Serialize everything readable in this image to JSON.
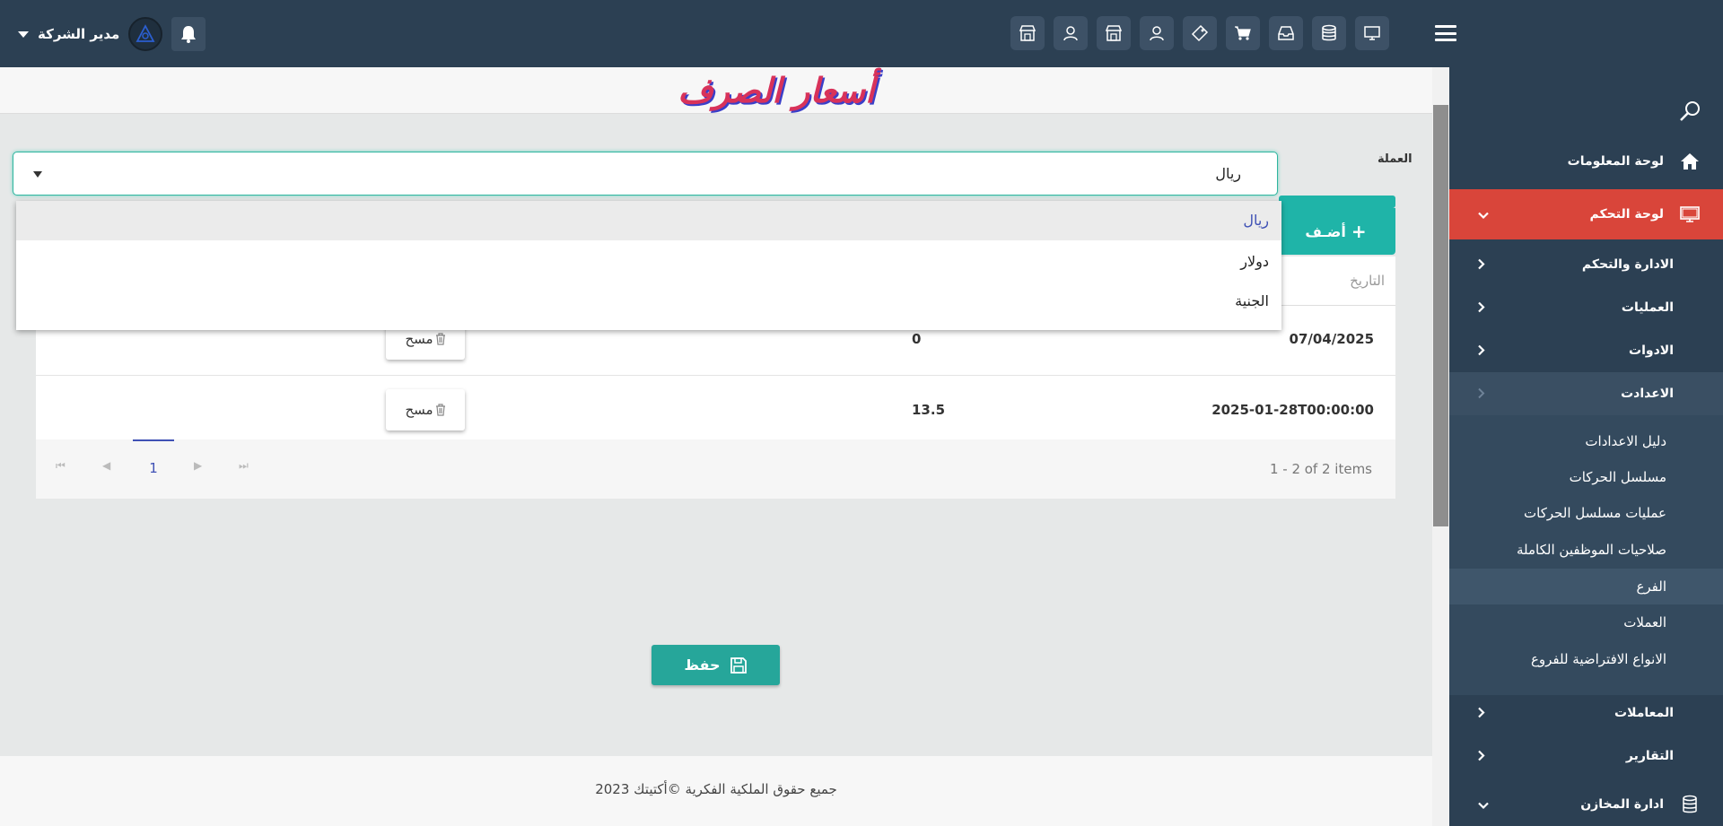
{
  "header": {
    "user_name": "مدير الشركة",
    "toolbar_icons": [
      "monitor-icon",
      "database-icon",
      "inbox-icon",
      "cart-icon",
      "tag-icon",
      "user-icon",
      "store-icon",
      "user-icon",
      "store-icon"
    ]
  },
  "page": {
    "title": "أسعار الصرف"
  },
  "form": {
    "currency_label": "العملة",
    "currency_selected": "ريال",
    "options": [
      "ريال",
      "دولار",
      "الجنية"
    ]
  },
  "grid": {
    "add_label": "أضـف",
    "date_header": "التاريخ",
    "rows": [
      {
        "date": "07/04/2025",
        "rate": "0",
        "delete_label": "مسح"
      },
      {
        "date": "2025-01-28T00:00:00",
        "rate": "13.5",
        "delete_label": "مسح"
      }
    ],
    "pager": {
      "current_page": "1",
      "info": "1 - 2 of 2 items"
    }
  },
  "actions": {
    "save_label": "حفظ"
  },
  "sidebar": {
    "items": [
      {
        "label": "لوحة المعلومات",
        "icon": "home-icon"
      },
      {
        "label": "لوحة التحكم",
        "icon": "monitor-icon"
      },
      {
        "label": "الادارة والتحكم"
      },
      {
        "label": "العمليات"
      },
      {
        "label": "الادوات"
      },
      {
        "label": "الاعدادت"
      }
    ],
    "submenu": [
      "دليل الاعدادات",
      "مسلسل الحركات",
      "عمليات مسلسل الحركات",
      "صلاحيات الموظفين الكاملة",
      "الفرع",
      "العملات",
      "الانواع الافتراضية للفروع"
    ],
    "bottom_items": [
      {
        "label": "المعاملات"
      },
      {
        "label": "التقارير"
      },
      {
        "label": "ادارة المخازن",
        "icon": "database-icon"
      }
    ]
  },
  "footer": {
    "text": "جميع حقوق الملكية الفكرية ©أكتيتك 2023"
  },
  "colors": {
    "topbar": "#2c4053",
    "accent_red": "#d9453a",
    "teal": "#1fb4a8",
    "title_pink": "#d8325a"
  }
}
